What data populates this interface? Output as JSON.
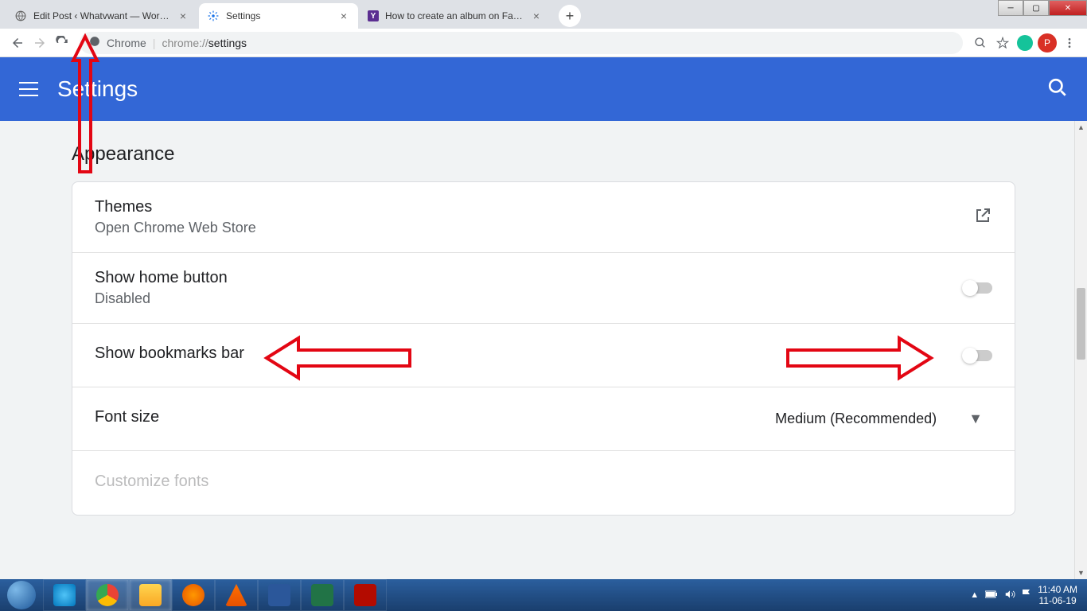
{
  "window": {
    "min": "—",
    "max": "▢",
    "close": "✕"
  },
  "tabs": [
    {
      "title": "Edit Post ‹ Whatvwant — WordP…",
      "favicon": "globe"
    },
    {
      "title": "Settings",
      "favicon": "gear"
    },
    {
      "title": "How to create an album on Face…",
      "favicon": "Y"
    }
  ],
  "toolbar": {
    "chrome_label": "Chrome",
    "url": "chrome://settings",
    "url_display": "settings"
  },
  "header": {
    "title": "Settings"
  },
  "section": {
    "title": "Appearance"
  },
  "rows": {
    "themes": {
      "title": "Themes",
      "sub": "Open Chrome Web Store"
    },
    "home": {
      "title": "Show home button",
      "sub": "Disabled"
    },
    "bookmarks": {
      "title": "Show bookmarks bar"
    },
    "font": {
      "title": "Font size",
      "value": "Medium (Recommended)"
    },
    "customize": {
      "title": "Customize fonts"
    }
  },
  "systray": {
    "time": "11:40 AM",
    "date": "11-06-19"
  }
}
